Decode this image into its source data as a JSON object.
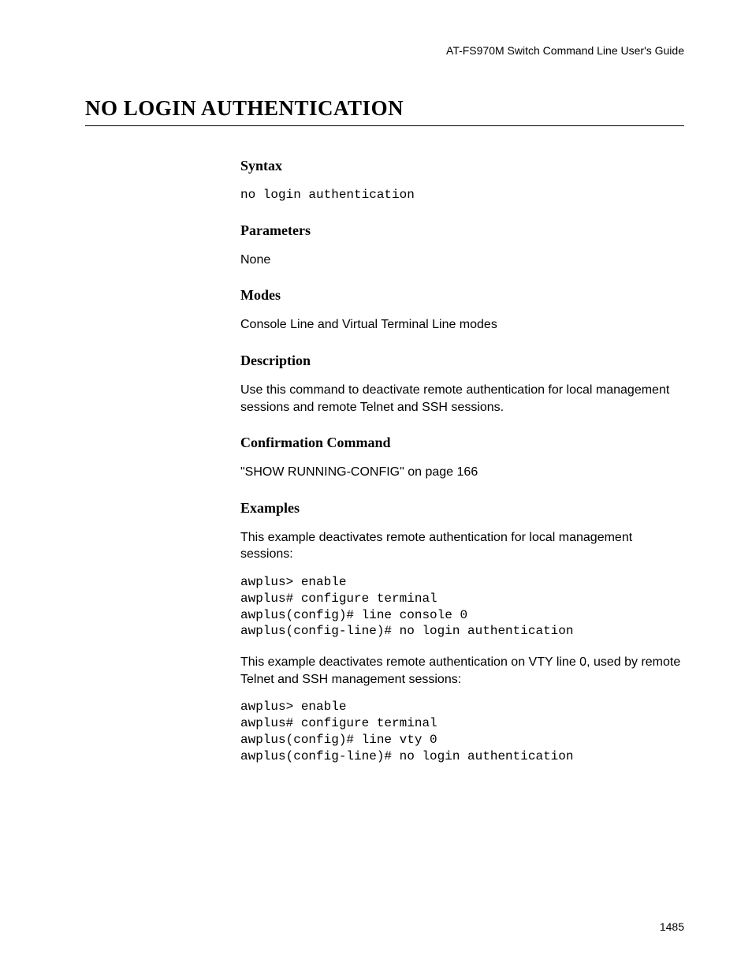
{
  "header": "AT-FS970M Switch Command Line User's Guide",
  "title": "NO LOGIN AUTHENTICATION",
  "sections": {
    "syntax": {
      "heading": "Syntax",
      "code": "no login authentication"
    },
    "parameters": {
      "heading": "Parameters",
      "text": "None"
    },
    "modes": {
      "heading": "Modes",
      "text": "Console Line and Virtual Terminal Line modes"
    },
    "description": {
      "heading": "Description",
      "text": "Use this command to deactivate remote authentication for local management sessions and remote Telnet and SSH sessions."
    },
    "confirmation": {
      "heading": "Confirmation Command",
      "text": "\"SHOW RUNNING-CONFIG\" on page 166"
    },
    "examples": {
      "heading": "Examples",
      "intro1": "This example deactivates remote authentication for local management sessions:",
      "code1": "awplus> enable\nawplus# configure terminal\nawplus(config)# line console 0\nawplus(config-line)# no login authentication",
      "intro2": "This example deactivates remote authentication on VTY line 0, used by remote Telnet and SSH management sessions:",
      "code2": "awplus> enable\nawplus# configure terminal\nawplus(config)# line vty 0\nawplus(config-line)# no login authentication"
    }
  },
  "pageNumber": "1485"
}
